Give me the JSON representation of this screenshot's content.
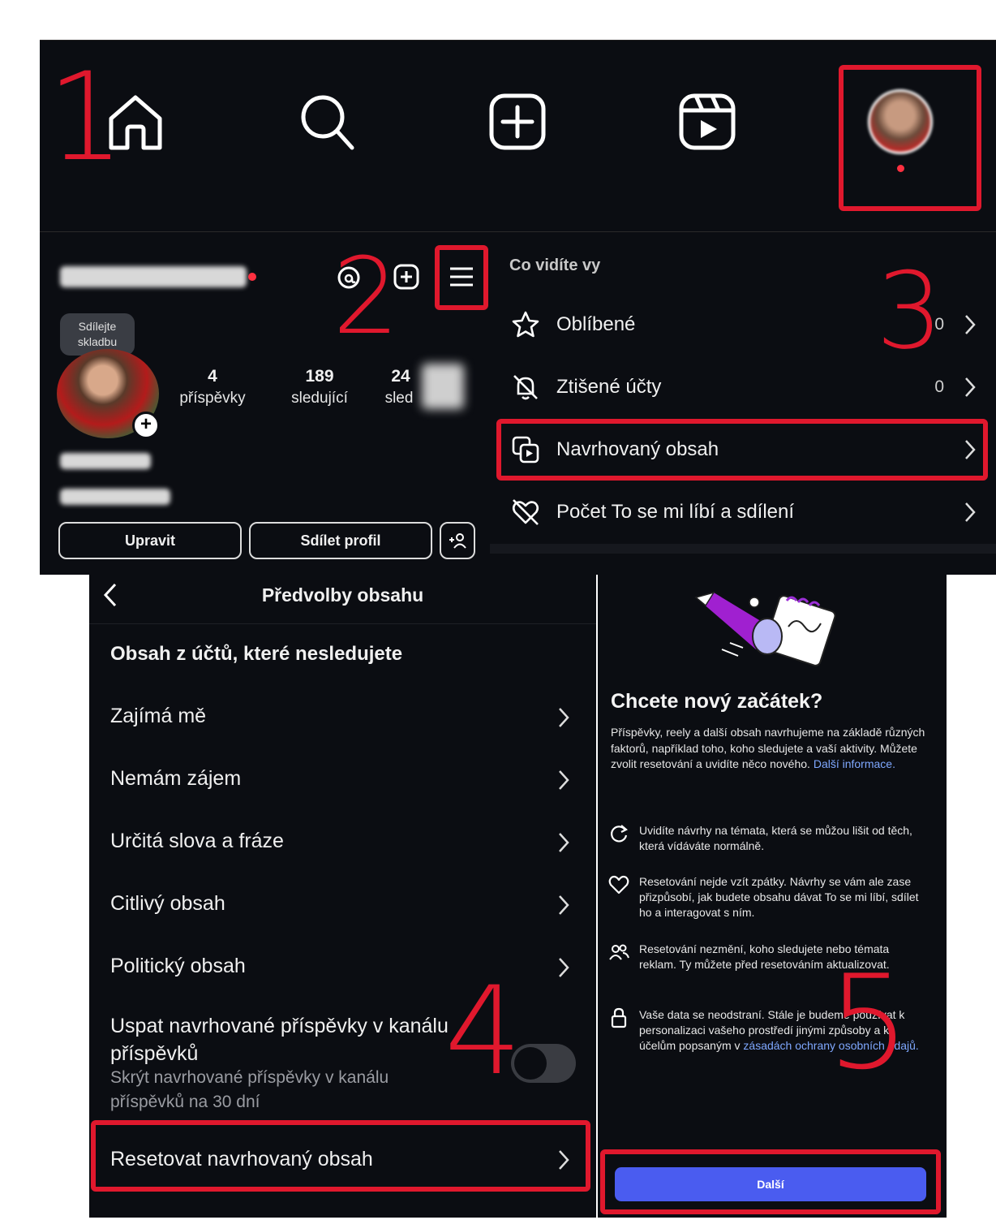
{
  "step_labels": [
    "1",
    "2",
    "3",
    "4",
    "5"
  ],
  "navbar": {
    "icons": [
      "home-icon",
      "search-icon",
      "create-icon",
      "reels-icon",
      "profile-avatar"
    ]
  },
  "profile": {
    "threads_icon": "threads-icon",
    "share_song_bubble": "Sdílejte skladbu",
    "stats": [
      {
        "value": "4",
        "label": "příspěvky"
      },
      {
        "value": "189",
        "label": "sledující"
      },
      {
        "value": "24",
        "label": "sled"
      }
    ],
    "edit_button": "Upravit",
    "share_button": "Sdílet profil"
  },
  "menu": {
    "section_title": "Co vidíte vy",
    "items": [
      {
        "label": "Oblíbené",
        "count": "0"
      },
      {
        "label": "Ztišené účty",
        "count": "0"
      },
      {
        "label": "Navrhovaný obsah",
        "count": ""
      },
      {
        "label": "Počet To se mi líbí a sdílení",
        "count": ""
      }
    ]
  },
  "prefs": {
    "title": "Předvolby obsahu",
    "section_title": "Obsah z účtů, které nesledujete",
    "items": [
      "Zajímá mě",
      "Nemám zájem",
      "Určitá slova a fráze",
      "Citlivý obsah",
      "Politický obsah"
    ],
    "snooze_title_1": "Uspat navrhované příspěvky v kanálu",
    "snooze_title_2": "příspěvků",
    "snooze_sub_1": "Skrýt navrhované příspěvky v kanálu",
    "snooze_sub_2": "příspěvků na 30 dní",
    "snooze_enabled": false,
    "reset_label": "Resetovat navrhovaný obsah"
  },
  "reset": {
    "title": "Chcete nový začátek?",
    "intro": "Příspěvky, reely a další obsah navrhujeme na základě různých faktorů, například toho, koho sledujete a vaší aktivity. Můžete zvolit resetování a uvidíte něco nového.",
    "intro_link": "Další informace.",
    "bullets": [
      {
        "icon": "refresh-icon",
        "text": "Uvidíte návrhy na témata, která se můžou lišit od těch, která vídáváte normálně."
      },
      {
        "icon": "heart-icon",
        "text": "Resetování nejde vzít zpátky. Návrhy se vám ale zase přizpůsobí, jak budete obsahu dávat To se mi líbí, sdílet ho a interagovat s ním."
      },
      {
        "icon": "people-icon",
        "text": "Resetování nezmění, koho sledujete nebo témata reklam. Ty můžete před resetováním aktualizovat."
      },
      {
        "icon": "lock-icon",
        "text": "Vaše data se neodstraní. Stále je budeme používat k personalizaci vašeho prostředí jinými způsoby a k účelům popsaným v",
        "link": "zásadách ochrany osobních údajů."
      }
    ],
    "next_button": "Další"
  },
  "colors": {
    "background": "#0b0d12",
    "annotation_red": "#e0182d",
    "primary_blue": "#4a5cf0",
    "link_blue": "#7fa8ff"
  }
}
